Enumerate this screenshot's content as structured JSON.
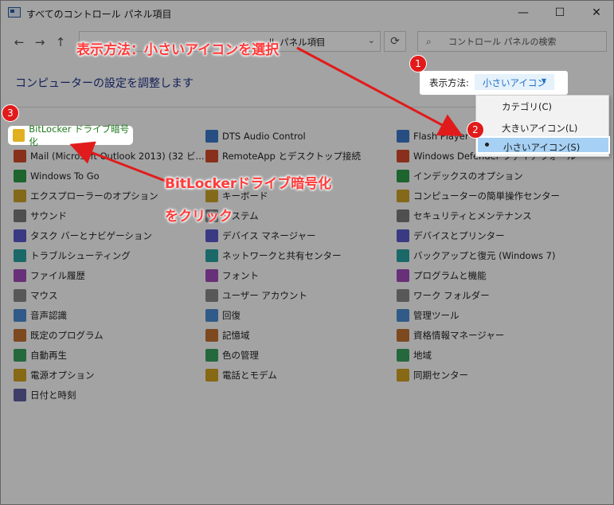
{
  "window": {
    "title": "すべてのコントロール パネル項目",
    "minimize": "—",
    "maximize": "☐",
    "close": "✕"
  },
  "nav": {
    "back": "←",
    "forward": "→",
    "up": "↑",
    "breadcrumb": "ル パネル項目",
    "breadcrumb_sep": "›",
    "dropdown": "⌄",
    "refresh": "⟳",
    "search_placeholder": "コントロール パネルの検索",
    "search_icon": "⌕"
  },
  "heading": "コンピューターの設定を調整します",
  "view_by": {
    "label": "表示方法:",
    "value": "小さいアイコン",
    "caret": "▼"
  },
  "view_menu": {
    "items": [
      "カテゴリ(C)",
      "大きいアイコン(L)",
      "小さいアイコン(S)"
    ],
    "selected": "小さいアイコン(S)"
  },
  "items_col1": [
    "BitLocker ドライブ暗号化",
    "Mail (Microsoft Outlook 2013) (32 ビ...",
    "Windows To Go",
    "エクスプローラーのオプション",
    "サウンド",
    "タスク バーとナビゲーション",
    "トラブルシューティング",
    "ファイル履歴",
    "マウス",
    "音声認識",
    "既定のプログラム",
    "自動再生",
    "電源オプション",
    "日付と時刻"
  ],
  "items_col2": [
    "DTS Audio Control",
    "RemoteApp とデスクトップ接続",
    "",
    "キーボード",
    "システム",
    "デバイス マネージャー",
    "ネットワークと共有センター",
    "フォント",
    "ユーザー アカウント",
    "回復",
    "記憶域",
    "色の管理",
    "電話とモデム"
  ],
  "items_col3": [
    "Flash Player",
    "Windows Defender ファイアウォール",
    "インデックスのオプション",
    "コンピューターの簡単操作センター",
    "セキュリティとメンテナンス",
    "デバイスとプリンター",
    "バックアップと復元 (Windows 7)",
    "プログラムと機能",
    "ワーク フォルダー",
    "管理ツール",
    "資格情報マネージャー",
    "地域",
    "同期センター"
  ],
  "annotations": {
    "badge1": "1",
    "badge2": "2",
    "badge3": "3",
    "text_top": "表示方法：小さいアイコンを選択",
    "text_mid1": "BitLockerドライブ暗号化",
    "text_mid2": "をクリック"
  },
  "colors": {
    "annotation_red": "#e11b1b",
    "link_blue": "#1e3287",
    "highlight_green": "#1f7a1f"
  }
}
